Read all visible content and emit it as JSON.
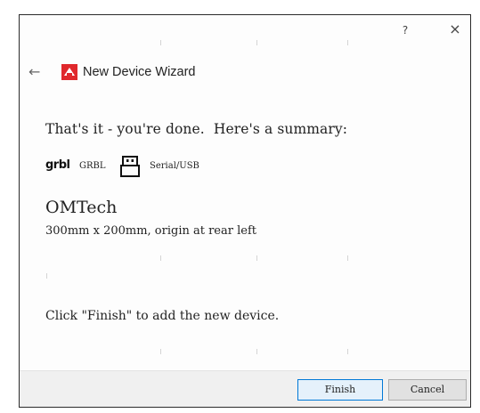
{
  "window": {
    "help_label": "?",
    "close_label": "×"
  },
  "header": {
    "back_label": "←",
    "title": "New Device Wizard"
  },
  "summary": {
    "line": "That's it - you're done.  Here's a summary:",
    "controller_logo": "grbl",
    "controller_name": "GRBL",
    "connection": "Serial/USB",
    "device_name": "OMTech",
    "device_description": "300mm x 200mm, origin at rear left",
    "finish_note": "Click \"Finish\" to add the new device."
  },
  "footer": {
    "finish_label": "Finish",
    "cancel_label": "Cancel"
  },
  "colors": {
    "accent_border": "#0078d7",
    "icon_red": "#e0282c"
  }
}
